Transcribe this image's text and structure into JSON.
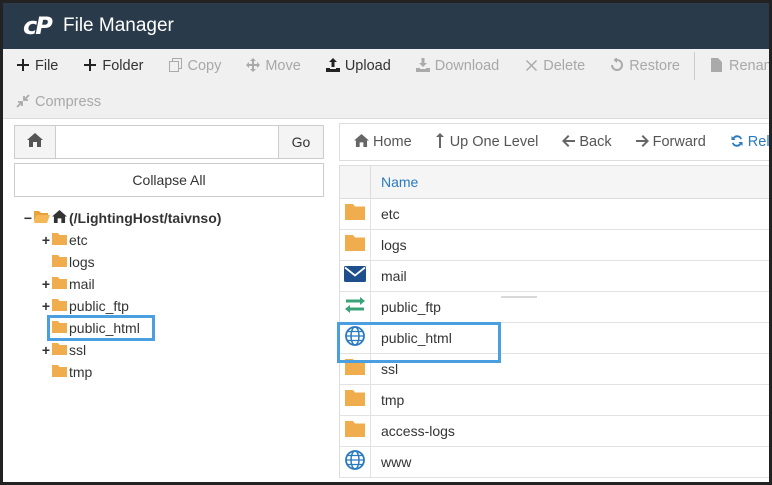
{
  "header": {
    "logo": "cP",
    "title": "File Manager"
  },
  "toolbar": {
    "row1": [
      {
        "label": "File",
        "icon": "plus-icon",
        "enabled": true
      },
      {
        "label": "Folder",
        "icon": "plus-icon",
        "enabled": true
      },
      {
        "label": "Copy",
        "icon": "copy-icon",
        "enabled": false
      },
      {
        "label": "Move",
        "icon": "move-icon",
        "enabled": false
      },
      {
        "label": "Upload",
        "icon": "upload-icon",
        "enabled": true
      },
      {
        "label": "Download",
        "icon": "download-icon",
        "enabled": false
      },
      {
        "label": "Delete",
        "icon": "delete-icon",
        "enabled": false
      },
      {
        "label": "Restore",
        "icon": "restore-icon",
        "enabled": false
      },
      {
        "label": "Rename",
        "icon": "rename-icon",
        "enabled": false
      }
    ],
    "row2": [
      {
        "label": "Compress",
        "icon": "compress-icon",
        "enabled": false
      }
    ]
  },
  "sidebar": {
    "path_value": "",
    "go_label": "Go",
    "collapse_label": "Collapse All",
    "root": "(/LightingHost/taivnso)",
    "tree": [
      {
        "label": "etc",
        "expandable": true
      },
      {
        "label": "logs",
        "expandable": false
      },
      {
        "label": "mail",
        "expandable": true
      },
      {
        "label": "public_ftp",
        "expandable": true
      },
      {
        "label": "public_html",
        "expandable": false
      },
      {
        "label": "ssl",
        "expandable": true
      },
      {
        "label": "tmp",
        "expandable": false
      }
    ]
  },
  "nav": {
    "home": "Home",
    "up": "Up One Level",
    "back": "Back",
    "forward": "Forward",
    "reload": "Reload"
  },
  "table": {
    "header_name": "Name",
    "rows": [
      {
        "name": "etc",
        "icon": "folder-icon"
      },
      {
        "name": "logs",
        "icon": "folder-icon"
      },
      {
        "name": "mail",
        "icon": "mail-icon"
      },
      {
        "name": "public_ftp",
        "icon": "transfer-icon"
      },
      {
        "name": "public_html",
        "icon": "globe-icon"
      },
      {
        "name": "ssl",
        "icon": "folder-icon"
      },
      {
        "name": "tmp",
        "icon": "folder-icon"
      },
      {
        "name": "access-logs",
        "icon": "folder-icon"
      },
      {
        "name": "www",
        "icon": "globe-icon"
      }
    ]
  },
  "colors": {
    "header_bg": "#293a4a",
    "folder": "#f0ad4e",
    "link_blue": "#2a7ac0",
    "highlight": "#4a9fe0",
    "mail_blue": "#1f4e8c",
    "ftp_green": "#3aa37a",
    "globe_blue": "#2a7ac0"
  }
}
